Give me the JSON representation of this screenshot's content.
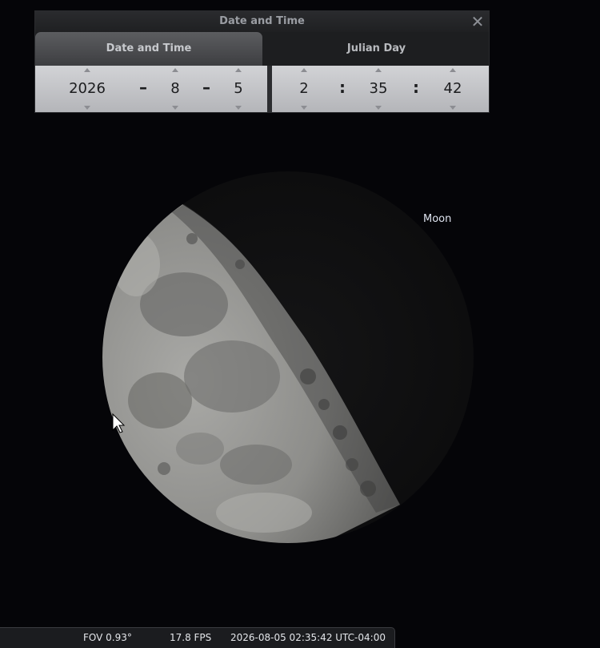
{
  "dialog": {
    "title": "Date and Time",
    "close_icon": "close-icon",
    "tabs": [
      {
        "label": "Date and Time",
        "active": true
      },
      {
        "label": "Julian Day",
        "active": false
      }
    ],
    "date": {
      "year": "2026",
      "month": "8",
      "day": "5",
      "separator": "–"
    },
    "time": {
      "hour": "2",
      "minute": "35",
      "second": "42",
      "separator": ":"
    }
  },
  "sky": {
    "object_label": "Moon"
  },
  "status_bar": {
    "fov": "FOV 0.93°",
    "fps": "17.8 FPS",
    "datetime": "2026-08-05 02:35:42 UTC-04:00"
  },
  "colors": {
    "background": "#050508",
    "panel": "#1a1b1d",
    "spinner": "#c4c5c9",
    "label": "#dfe4f0"
  }
}
